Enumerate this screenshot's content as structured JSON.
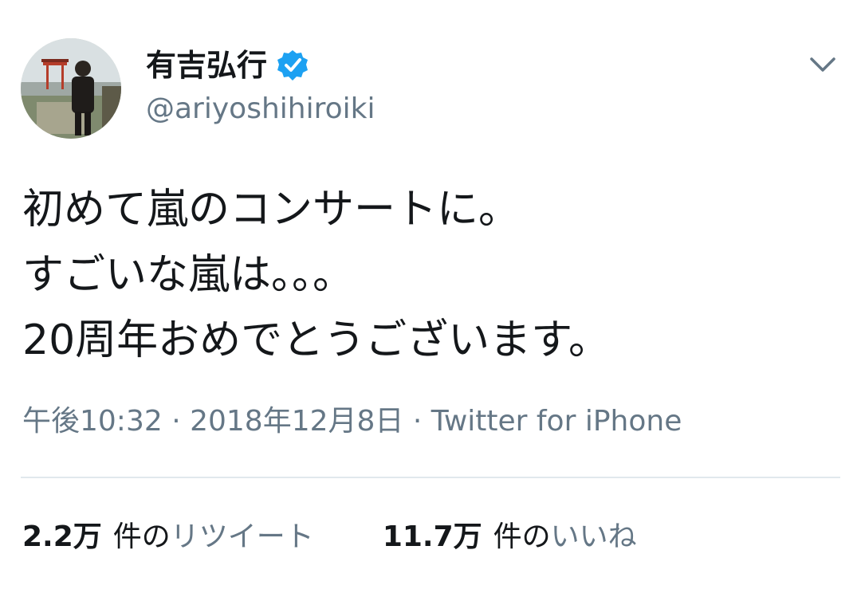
{
  "tweet": {
    "display_name": "有吉弘行",
    "handle": "@ariyoshihiroiki",
    "verified": true,
    "body_lines": [
      "初めて嵐のコンサートに。",
      "すごいな嵐は。。。",
      "20周年おめでとうございます。"
    ],
    "time": "午後10:32",
    "separator": " · ",
    "date": "2018年12月8日",
    "source": "Twitter for iPhone",
    "retweets": {
      "count": "2.2万",
      "unit": "件の",
      "label": "リツイート"
    },
    "likes": {
      "count": "11.7万",
      "unit": "件の",
      "label": "いいね"
    }
  },
  "icons": {
    "verified": "verified-badge-icon",
    "menu": "chevron-down-icon"
  },
  "colors": {
    "text_primary": "#14171a",
    "text_secondary": "#657786",
    "verified_blue": "#1da1f2",
    "divider": "#e1e8ed"
  }
}
